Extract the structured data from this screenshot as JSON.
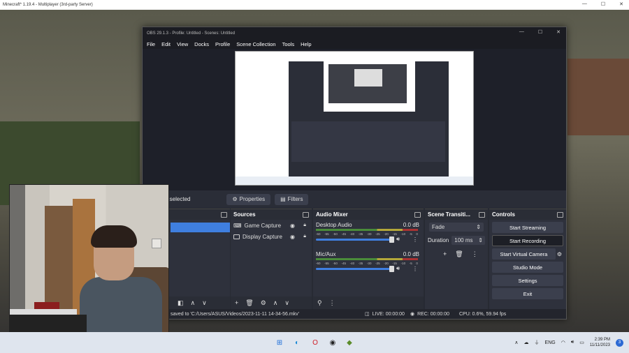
{
  "outer_window": {
    "title": "Minecraft* 1.19.4 - Multiplayer (3rd-party Server)"
  },
  "obs": {
    "title": "OBS 29.1.3 - Profile: Untitled - Scenes: Untitled",
    "menu": [
      "File",
      "Edit",
      "View",
      "Docks",
      "Profile",
      "Scene Collection",
      "Tools",
      "Help"
    ],
    "tabs": {
      "selected": "e selected",
      "properties": "Properties",
      "filters": "Filters"
    },
    "sources": {
      "title": "Sources",
      "items": [
        {
          "label": "Game Capture",
          "icon": "gamepad-icon"
        },
        {
          "label": "Display Capture",
          "icon": "monitor-icon"
        }
      ]
    },
    "audio_mixer": {
      "title": "Audio Mixer",
      "ticks": [
        "-60",
        "-55",
        "-50",
        "-45",
        "-40",
        "-35",
        "-30",
        "-25",
        "-20",
        "-15",
        "-10",
        "-5",
        "0"
      ],
      "channels": [
        {
          "name": "Desktop Audio",
          "db": "0.0 dB"
        },
        {
          "name": "Mic/Aux",
          "db": "0.0 dB"
        }
      ]
    },
    "transitions": {
      "title": "Scene Transiti...",
      "selected": "Fade",
      "duration_label": "Duration",
      "duration_value": "100 ms"
    },
    "controls": {
      "title": "Controls",
      "buttons": [
        "Start Streaming",
        "Start Recording",
        "Start Virtual Camera",
        "Studio Mode",
        "Settings",
        "Exit"
      ]
    },
    "status": {
      "saved": "saved to 'C:/Users/ASUS/Videos/2023-11-11 14-34-56.mkv'",
      "live": "LIVE: 00:00:00",
      "rec": "REC: 00:00:00",
      "cpu": "CPU: 0.6%, 59.94 fps"
    }
  },
  "taskbar": {
    "lang": "ENG",
    "time": "2:39 PM",
    "date": "11/11/2023",
    "notifications": "3"
  },
  "colors": {
    "accent": "#3f7fe0",
    "obs_bg": "#272a33",
    "panel_bg": "#2e313c"
  }
}
